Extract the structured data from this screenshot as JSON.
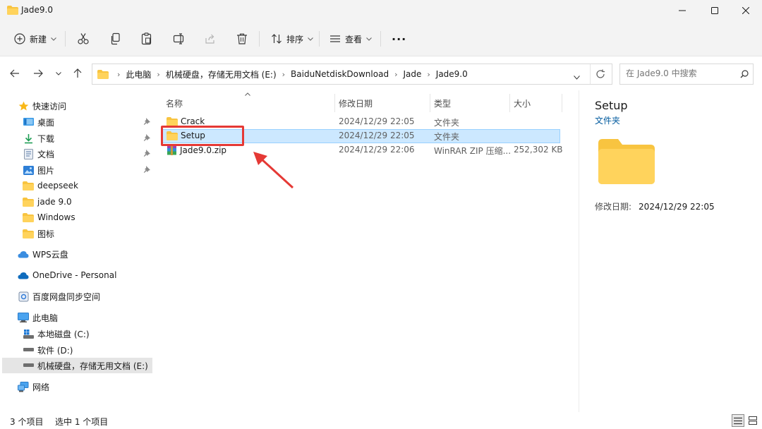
{
  "window": {
    "title": "Jade9.0"
  },
  "toolbar": {
    "new_label": "新建",
    "sort_label": "排序",
    "view_label": "查看",
    "more_label": "···"
  },
  "address": {
    "crumbs": [
      "此电脑",
      "机械硬盘，存储无用文档 (E:)",
      "BaiduNetdiskDownload",
      "Jade",
      "Jade9.0"
    ],
    "search_placeholder": "在 Jade9.0 中搜索"
  },
  "sidebar": {
    "quick_access": "快速访问",
    "pinned": [
      {
        "label": "桌面",
        "icon": "desktop-icon"
      },
      {
        "label": "下载",
        "icon": "download-icon"
      },
      {
        "label": "文档",
        "icon": "document-icon"
      },
      {
        "label": "图片",
        "icon": "picture-icon"
      }
    ],
    "folders": [
      "deepseek",
      "jade 9.0",
      "Windows",
      "图标"
    ],
    "wps": "WPS云盘",
    "onedrive": "OneDrive - Personal",
    "baidu": "百度网盘同步空间",
    "this_pc": "此电脑",
    "drives": [
      "本地磁盘 (C:)",
      "软件 (D:)",
      "机械硬盘，存储无用文档 (E:)"
    ],
    "network": "网络"
  },
  "columns": {
    "name": "名称",
    "date": "修改日期",
    "type": "类型",
    "size": "大小"
  },
  "files": [
    {
      "name": "Crack",
      "date": "2024/12/29 22:05",
      "type": "文件夹",
      "size": "",
      "icon": "folder-icon"
    },
    {
      "name": "Setup",
      "date": "2024/12/29 22:05",
      "type": "文件夹",
      "size": "",
      "icon": "folder-icon"
    },
    {
      "name": "Jade9.0.zip",
      "date": "2024/12/29 22:06",
      "type": "WinRAR ZIP 压缩...",
      "size": "252,302 KB",
      "icon": "winrar-archive-icon"
    }
  ],
  "preview": {
    "title": "Setup",
    "type": "文件夹",
    "meta_label": "修改日期:",
    "meta_value": "2024/12/29 22:05"
  },
  "status": {
    "count": "3 个项目",
    "selected": "选中 1 个项目"
  },
  "colors": {
    "selection": "#cce8ff",
    "accent": "#005a9e",
    "highlight": "#e53935",
    "folder": "#ffd35c"
  }
}
